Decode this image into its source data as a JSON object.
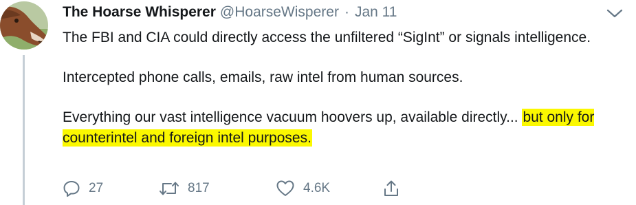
{
  "tweet": {
    "author_name": "The Hoarse Whisperer",
    "handle": "@HoarseWisperer",
    "separator": "·",
    "date": "Jan 11",
    "paragraphs": [
      "The FBI and CIA could directly access the unfiltered “SigInt” or signals intelligence.",
      "Intercepted phone calls, emails, raw intel from human sources."
    ],
    "last_paragraph_plain": "Everything our vast intelligence vacuum hoovers up, available directly... ",
    "last_paragraph_highlight": "but only for counterintel and foreign intel purposes.",
    "highlight_color": "#fbf800"
  },
  "actions": {
    "reply_count": "27",
    "retweet_count": "817",
    "like_count": "4.6K"
  },
  "icons": {
    "avatar": "horse-avatar",
    "caret": "chevron-down-icon",
    "reply": "reply-icon",
    "retweet": "retweet-icon",
    "like": "heart-icon",
    "share": "share-icon"
  },
  "colors": {
    "text": "#14171a",
    "secondary": "#657786",
    "thread_line": "#c5ced6"
  }
}
